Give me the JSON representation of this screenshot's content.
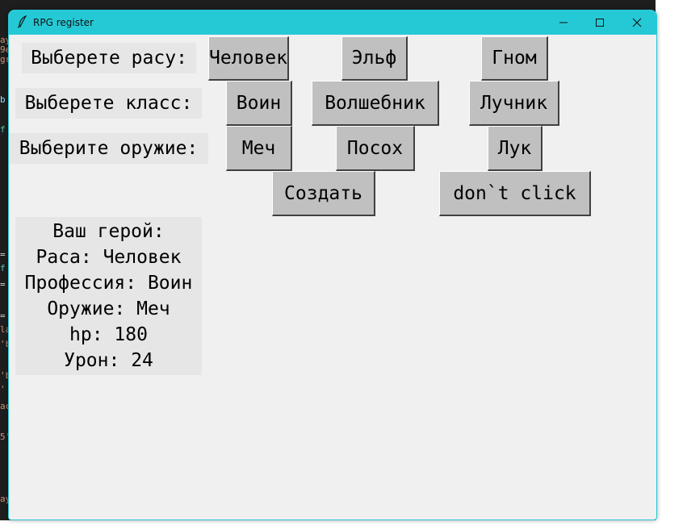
{
  "window": {
    "title": "RPG register",
    "title_bar_color": "#25c9d5",
    "icons": [
      "feather-icon",
      "minimize-icon",
      "maximize-icon",
      "close-icon"
    ]
  },
  "race": {
    "label": "Выберете расу:",
    "options": [
      "Человек",
      "Эльф",
      "Гном"
    ]
  },
  "class": {
    "label": "Выберете класс:",
    "options": [
      "Воин",
      "Волшебник",
      "Лучник"
    ]
  },
  "weapon": {
    "label": "Выберите оружие:",
    "options": [
      "Меч",
      "Посох",
      "Лук"
    ]
  },
  "actions": {
    "create": "Создать",
    "dont_click": "don`t click"
  },
  "hero": {
    "title": "Ваш герой:",
    "race": "Раса: Человек",
    "profession": "Профессия: Воин",
    "weapon": "Оружие: Меч",
    "hp": "hp: 180",
    "damage": "Урон: 24"
  },
  "background_code": [
    {
      "text": "ay",
      "color": "#ce9178"
    },
    {
      "text": "9e",
      "color": "#ce9178"
    },
    {
      "text": "gr",
      "color": "#ce9178"
    },
    {
      "text": "b",
      "color": "#9cdcfe"
    },
    {
      "text": "f",
      "color": "#4ec9b0"
    },
    {
      "text": "=",
      "color": "#d4d4d4"
    },
    {
      "text": "f",
      "color": "#4ec9b0"
    },
    {
      "text": "=",
      "color": "#d4d4d4"
    },
    {
      "text": "=",
      "color": "#d4d4d4"
    },
    {
      "text": "la",
      "color": "#ce9178"
    },
    {
      "text": "'b",
      "color": "#ce9178"
    },
    {
      "text": "'b",
      "color": "#ce9178"
    },
    {
      "text": "'",
      "color": "#ce9178"
    },
    {
      "text": "ac",
      "color": "#ce9178"
    },
    {
      "text": "5'",
      "color": "#ce9178"
    },
    {
      "text": "ay",
      "color": "#ce9178"
    }
  ]
}
